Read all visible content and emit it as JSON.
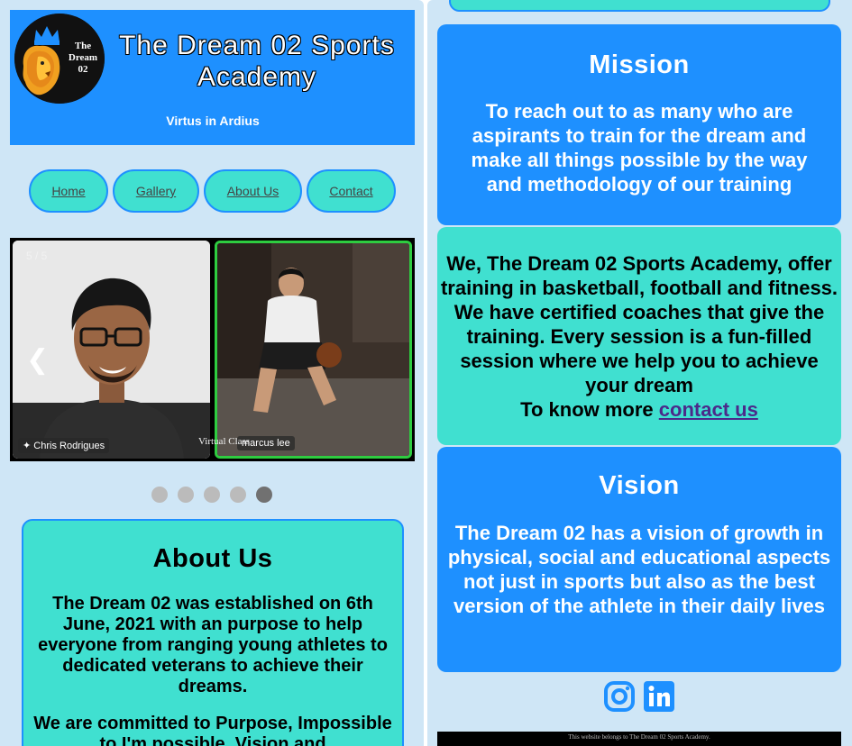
{
  "header": {
    "logo_text": [
      "The",
      "Dream",
      "02"
    ],
    "title_line1": "The Dream 02 Sports",
    "title_line2": "Academy",
    "tagline": "Virtus in Ardius"
  },
  "nav": {
    "items": [
      {
        "label": "Home"
      },
      {
        "label": "Gallery"
      },
      {
        "label": "About Us"
      },
      {
        "label": "Contact"
      }
    ]
  },
  "slideshow": {
    "counter": "5 / 5",
    "prev_icon": "❮",
    "caption": "Virtual Class",
    "tiles": [
      {
        "name": "Chris Rodrigues"
      },
      {
        "name": "marcus lee"
      }
    ],
    "dots": {
      "count": 5,
      "active_index": 4
    }
  },
  "about": {
    "title": "About Us",
    "text": "The Dream 02 was established on 6th June, 2021 with an purpose to help everyone from ranging young athletes to dedicated veterans to achieve their dreams.",
    "text2": "We are committed to Purpose, Impossible to I'm possible, Vision and"
  },
  "mission": {
    "title": "Mission",
    "text": "To reach out to as many who are aspirants to train for the dream and make all things possible by the way and methodology of our training"
  },
  "offer": {
    "text": "We, The Dream 02 Sports Academy, offer training in basketball, football and fitness. We have certified coaches that give the training. Every session is a fun-filled session where we help you to achieve your dream",
    "know_more": "To know more ",
    "link": "contact us"
  },
  "vision": {
    "title": "Vision",
    "text": "The Dream 02 has a vision of growth in physical, social and educational aspects not just in sports but also as the best version of the athlete in their daily lives"
  },
  "social": {
    "icons": [
      "instagram-icon",
      "linkedin-icon"
    ]
  },
  "footer": {
    "text": "This website belongs to The Dream 02 Sports Academy."
  },
  "colors": {
    "primary": "#1e90ff",
    "accent": "#40e0d0",
    "background": "#cfe6f6"
  }
}
